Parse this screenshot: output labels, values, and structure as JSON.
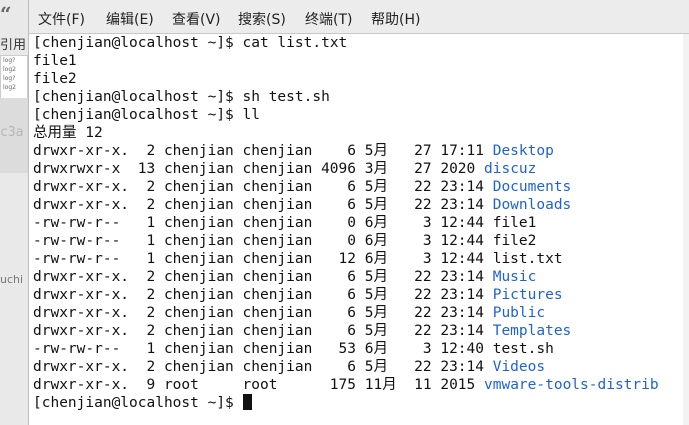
{
  "left_window": {
    "quote": "“",
    "text1": "引用",
    "log_lines": [
      "log?",
      "log2",
      "log?",
      "log2"
    ],
    "text2": "c3a",
    "text3": "uchi"
  },
  "menu": [
    {
      "label": "文件(F)"
    },
    {
      "label": "编辑(E)"
    },
    {
      "label": "查看(V)"
    },
    {
      "label": "搜索(S)"
    },
    {
      "label": "终端(T)"
    },
    {
      "label": "帮助(H)"
    }
  ],
  "prompt": "[chenjian@localhost ~]$ ",
  "lines": [
    {
      "cmd": "cat list.txt"
    },
    {
      "text": "file1"
    },
    {
      "text": "file2"
    },
    {
      "cmd": "sh test.sh"
    },
    {
      "cmd": "ll"
    },
    {
      "text": "总用量 12"
    },
    {
      "meta": "drwxr-xr-x.  2 chenjian chenjian    6 5月   27 17:11 ",
      "name": "Desktop",
      "link": true
    },
    {
      "meta": "drwxrwxr-x  13 chenjian chenjian 4096 3月   27 2020 ",
      "name": "discuz",
      "link": true
    },
    {
      "meta": "drwxr-xr-x.  2 chenjian chenjian    6 5月   22 23:14 ",
      "name": "Documents",
      "link": true
    },
    {
      "meta": "drwxr-xr-x.  2 chenjian chenjian    6 5月   22 23:14 ",
      "name": "Downloads",
      "link": true
    },
    {
      "meta": "-rw-rw-r--   1 chenjian chenjian    0 6月    3 12:44 ",
      "name": "file1",
      "link": false
    },
    {
      "meta": "-rw-rw-r--   1 chenjian chenjian    0 6月    3 12:44 ",
      "name": "file2",
      "link": false
    },
    {
      "meta": "-rw-rw-r--   1 chenjian chenjian   12 6月    3 12:44 ",
      "name": "list.txt",
      "link": false
    },
    {
      "meta": "drwxr-xr-x.  2 chenjian chenjian    6 5月   22 23:14 ",
      "name": "Music",
      "link": true
    },
    {
      "meta": "drwxr-xr-x.  2 chenjian chenjian    6 5月   22 23:14 ",
      "name": "Pictures",
      "link": true
    },
    {
      "meta": "drwxr-xr-x.  2 chenjian chenjian    6 5月   22 23:14 ",
      "name": "Public",
      "link": true
    },
    {
      "meta": "drwxr-xr-x.  2 chenjian chenjian    6 5月   22 23:14 ",
      "name": "Templates",
      "link": true
    },
    {
      "meta": "-rw-rw-r--   1 chenjian chenjian   53 6月    3 12:40 ",
      "name": "test.sh",
      "link": false
    },
    {
      "meta": "drwxr-xr-x.  2 chenjian chenjian    6 5月   22 23:14 ",
      "name": "Videos",
      "link": true
    },
    {
      "meta": "drwxr-xr-x.  9 root     root      175 11月  11 2015 ",
      "name": "vmware-tools-distrib",
      "link": true
    },
    {
      "cmd": "",
      "cursor": true
    }
  ],
  "colors": {
    "link": "#1f62d4",
    "text": "#111111",
    "menubar_bg": "#ececec"
  }
}
